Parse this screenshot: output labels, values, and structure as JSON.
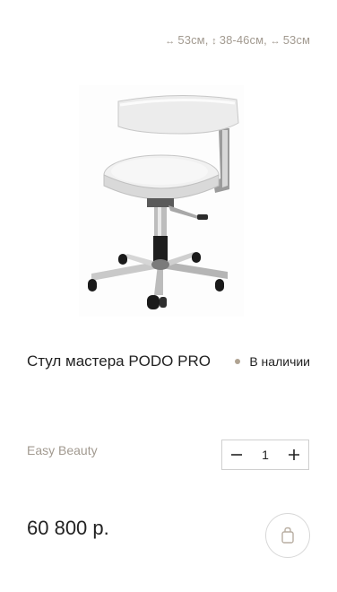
{
  "product": {
    "dimensions": {
      "width_icon": "width-arrows-icon",
      "height_icon": "height-arrows-icon",
      "depth_icon": "depth-arrows-icon",
      "width": "53см,",
      "height": "38-46см,",
      "depth": "53см"
    },
    "image_alt": "Стул мастера PODO PRO",
    "title": "Стул мастера PODO PRO",
    "stock_status": "В наличии",
    "brand": "Easy Beauty",
    "quantity": "1",
    "price": "60 800 р."
  },
  "colors": {
    "accent_muted": "#a29a90",
    "stock_dot": "#b0a392",
    "border": "#cfcfcf"
  }
}
